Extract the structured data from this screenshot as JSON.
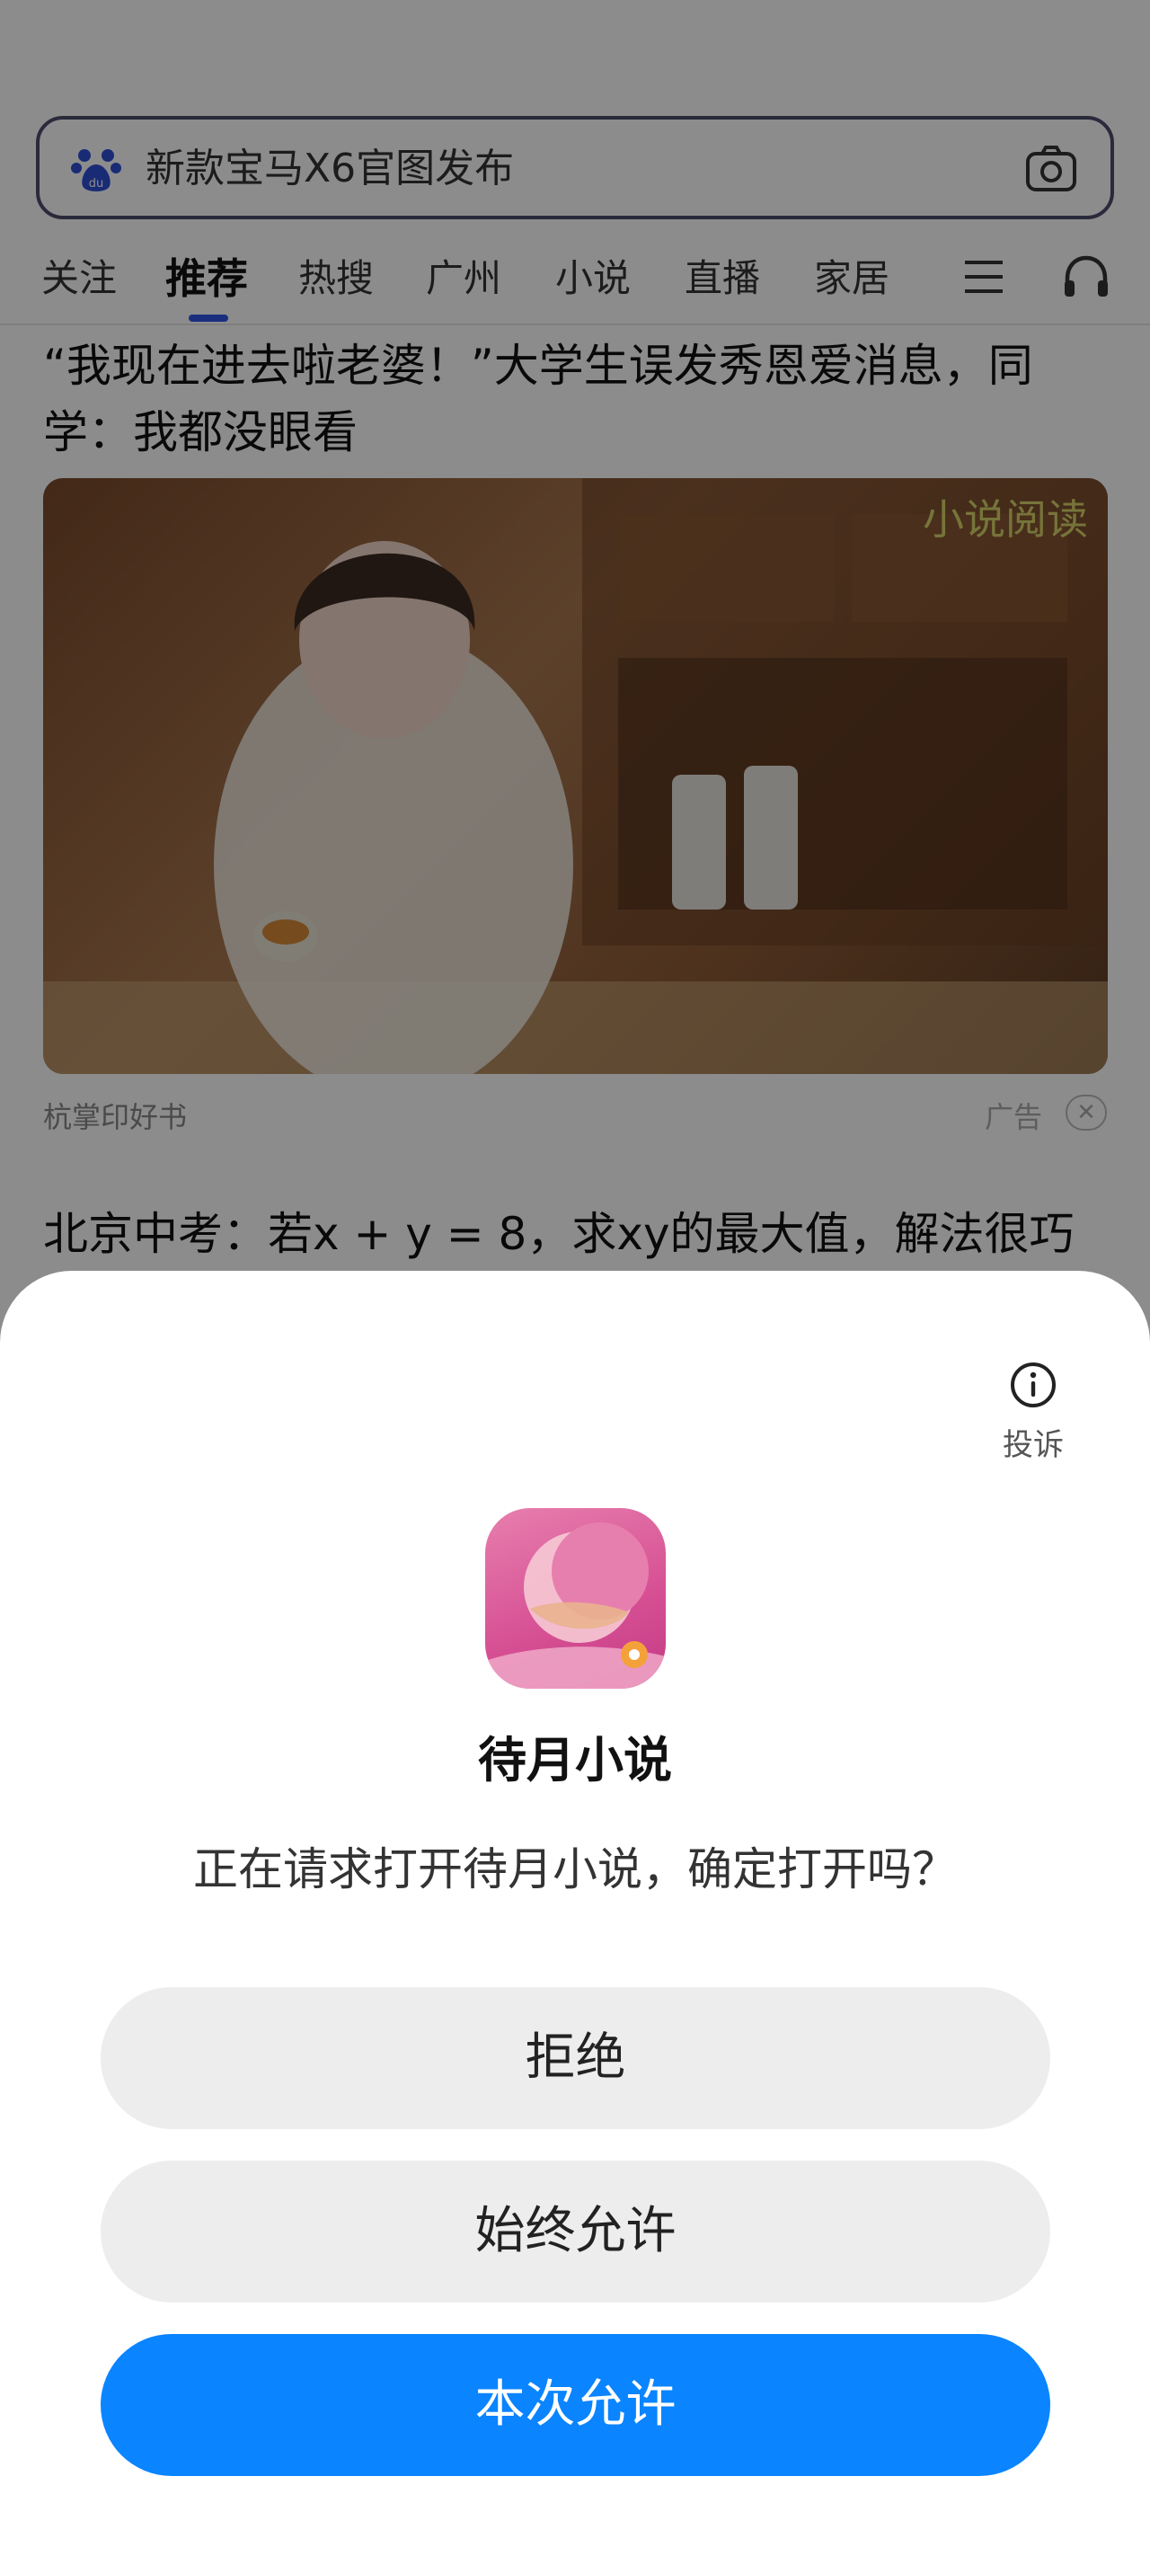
{
  "search": {
    "placeholder": "新款宝马X6官图发布"
  },
  "tabs": [
    {
      "label": "关注"
    },
    {
      "label": "推荐"
    },
    {
      "label": "热搜"
    },
    {
      "label": "广州"
    },
    {
      "label": "小说"
    },
    {
      "label": "直播"
    },
    {
      "label": "家居"
    }
  ],
  "feed": {
    "headline1": "“我现在进去啦老婆！”大学生误发秀恩爱消息，同学：我都没眼看",
    "ad": {
      "tag": "小说阅读",
      "source": "杭掌印好书",
      "label": "广告",
      "close": "✕"
    },
    "headline2": "北京中考：若x + y = 8，求xy的最大值，解法很巧"
  },
  "sheet": {
    "report_label": "投诉",
    "app_name": "待月小说",
    "message": "正在请求打开待月小说，确定打开吗？",
    "buttons": {
      "deny": "拒绝",
      "always": "始终允许",
      "once": "本次允许"
    }
  },
  "colors": {
    "primary_button": "#0a84ff",
    "secondary_button": "#ededed",
    "tab_indicator": "#2f57e6",
    "app_icon": "#d64f93"
  },
  "icons": [
    "baidu-paw-icon",
    "camera-icon",
    "menu-icon",
    "headset-icon",
    "info-icon",
    "close-icon"
  ]
}
